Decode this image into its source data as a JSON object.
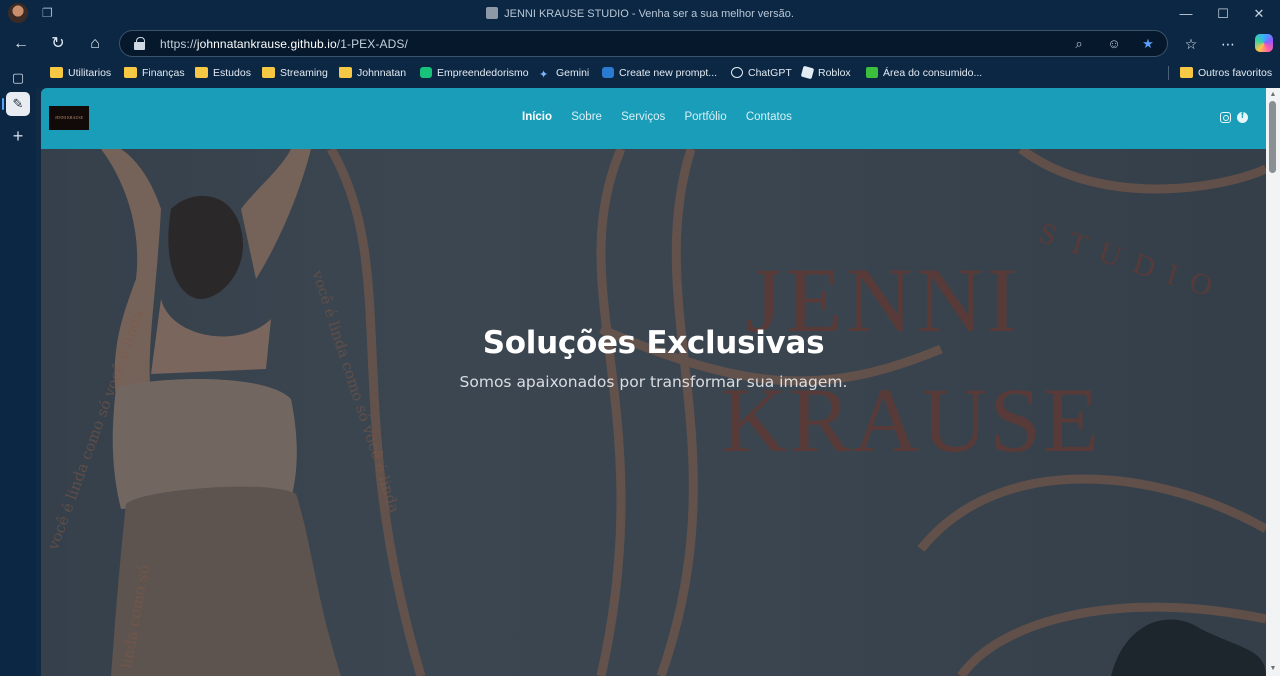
{
  "browser": {
    "window_title": "JENNI KRAUSE STUDIO - Venha ser a sua melhor versão.",
    "url_prefix": "https://",
    "url_host": "johnnatankrause.github.io",
    "url_path": "/1-PEX-ADS/",
    "win_minimize": "—",
    "win_maximize": "☐",
    "win_close": "✕"
  },
  "bookmarks": [
    {
      "label": "Utilitarios",
      "icon": "folder-icon"
    },
    {
      "label": "Finanças",
      "icon": "folder-icon"
    },
    {
      "label": "Estudos",
      "icon": "folder-icon"
    },
    {
      "label": "Streaming",
      "icon": "folder-icon"
    },
    {
      "label": "Johnnatan",
      "icon": "folder-icon"
    },
    {
      "label": "Empreendedorismo",
      "icon": "green-app-icon"
    },
    {
      "label": "Gemini",
      "icon": "gemini-star-icon"
    },
    {
      "label": "Create new prompt...",
      "icon": "prompt-icon"
    },
    {
      "label": "ChatGPT",
      "icon": "chatgpt-icon"
    },
    {
      "label": "Roblox",
      "icon": "roblox-icon"
    },
    {
      "label": "Área do consumido...",
      "icon": "green-r-icon"
    },
    {
      "label": "Outros favoritos",
      "icon": "folder-icon"
    }
  ],
  "site": {
    "nav": [
      "Início",
      "Sobre",
      "Serviços",
      "Portfólio",
      "Contatos"
    ],
    "logo_text": "JENNI KRAUSE",
    "hero_title": "Soluções Exclusivas",
    "hero_subtitle": "Somos apaixonados por transformar sua imagem.",
    "bg_brand_line1": "JENNI",
    "bg_brand_line2": "KRAUSE",
    "bg_brand_tag": "STUDIO",
    "bg_circle_text": "você é linda como só você é linda como só você é linda como só",
    "colors": {
      "navbar": "#199db9",
      "accent_lines": "#c77a50",
      "brand_text": "#8a4a3c"
    }
  }
}
